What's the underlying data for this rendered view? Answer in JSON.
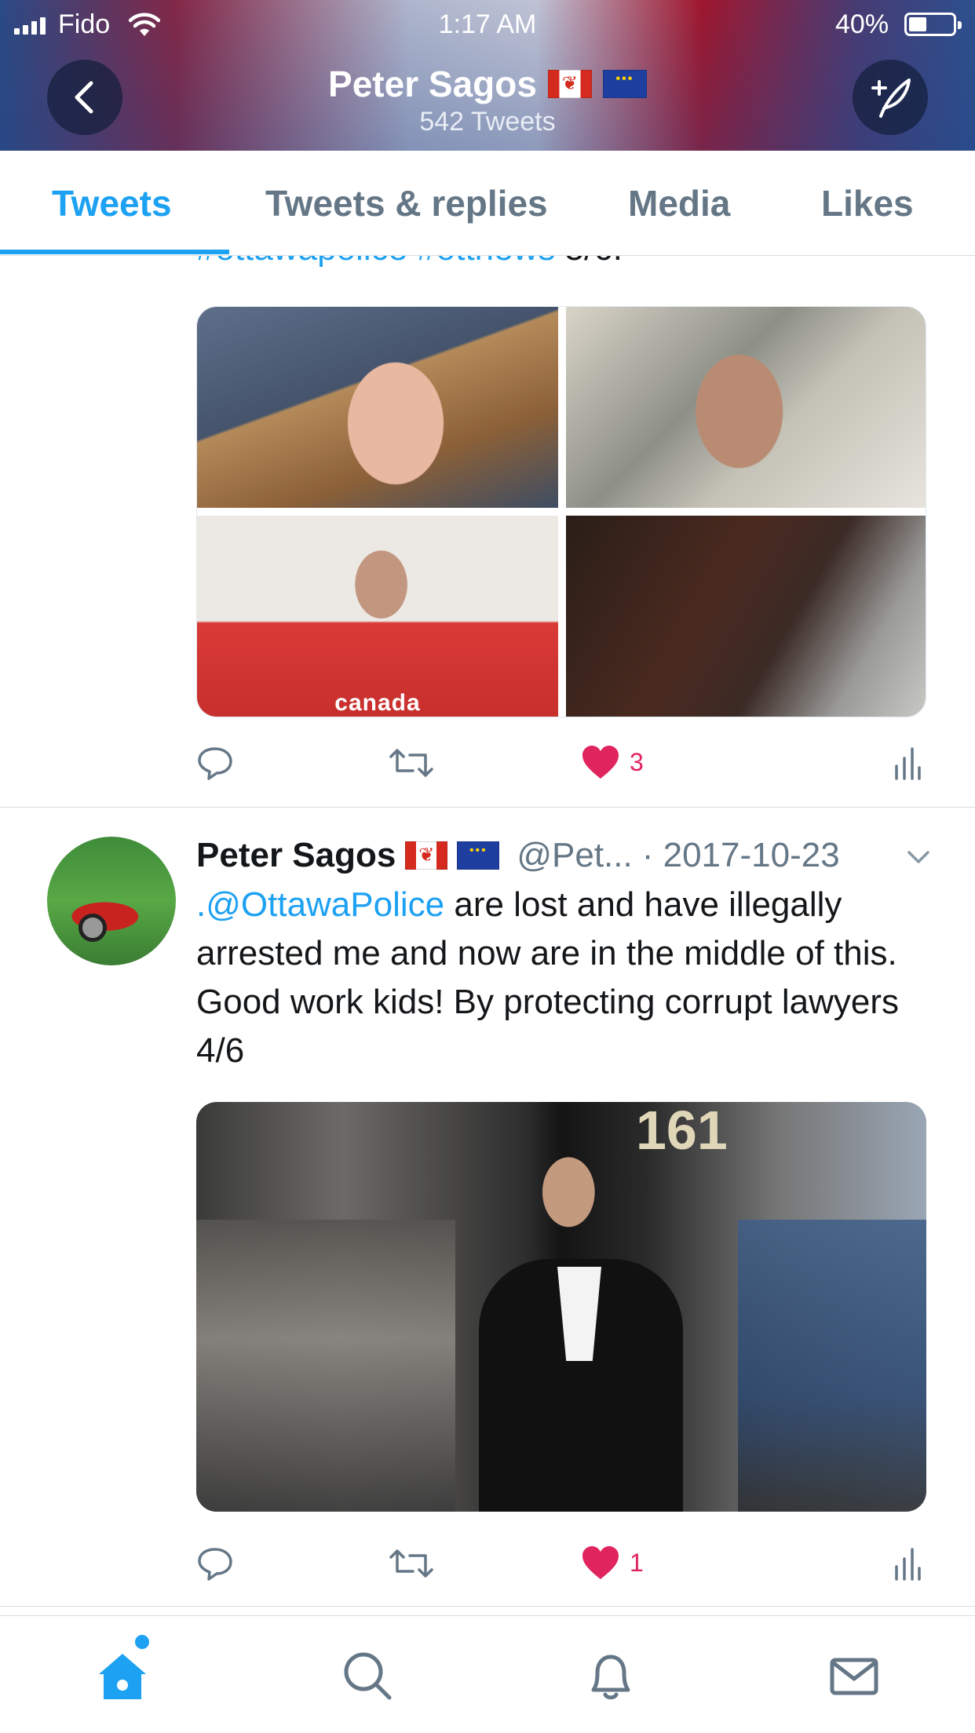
{
  "status_bar": {
    "carrier": "Fido",
    "time": "1:17 AM",
    "battery": "40%",
    "battery_level": 0.4
  },
  "header": {
    "name": "Peter Sagos",
    "tweet_count": "542 Tweets"
  },
  "tabs": [
    {
      "label": "Tweets",
      "active": true
    },
    {
      "label": "Tweets & replies",
      "active": false
    },
    {
      "label": "Media",
      "active": false
    },
    {
      "label": "Likes",
      "active": false
    }
  ],
  "tweet_1": {
    "cut_text_links": "#ottawapolice #ottnews",
    "cut_text_rest": " 5/6.",
    "image_caption": "canada",
    "like_count": "3"
  },
  "tweet_2": {
    "name": "Peter Sagos",
    "handle": "@Pet...",
    "date": "· 2017-10-23",
    "mention": ".@OttawaPolice",
    "text": " are lost and have illegally arrested me and now are in the middle of this. Good work kids! By protecting corrupt lawyers 4/6",
    "image_number": "161",
    "like_count": "1"
  },
  "colors": {
    "accent": "#1da1f2",
    "like": "#e0245e",
    "muted": "#657786"
  },
  "icons": {
    "reply": "reply-icon",
    "retweet": "retweet-icon",
    "like": "heart-icon",
    "analytics": "analytics-icon",
    "home": "home-icon",
    "search": "search-icon",
    "notifications": "bell-icon",
    "messages": "mail-icon"
  }
}
